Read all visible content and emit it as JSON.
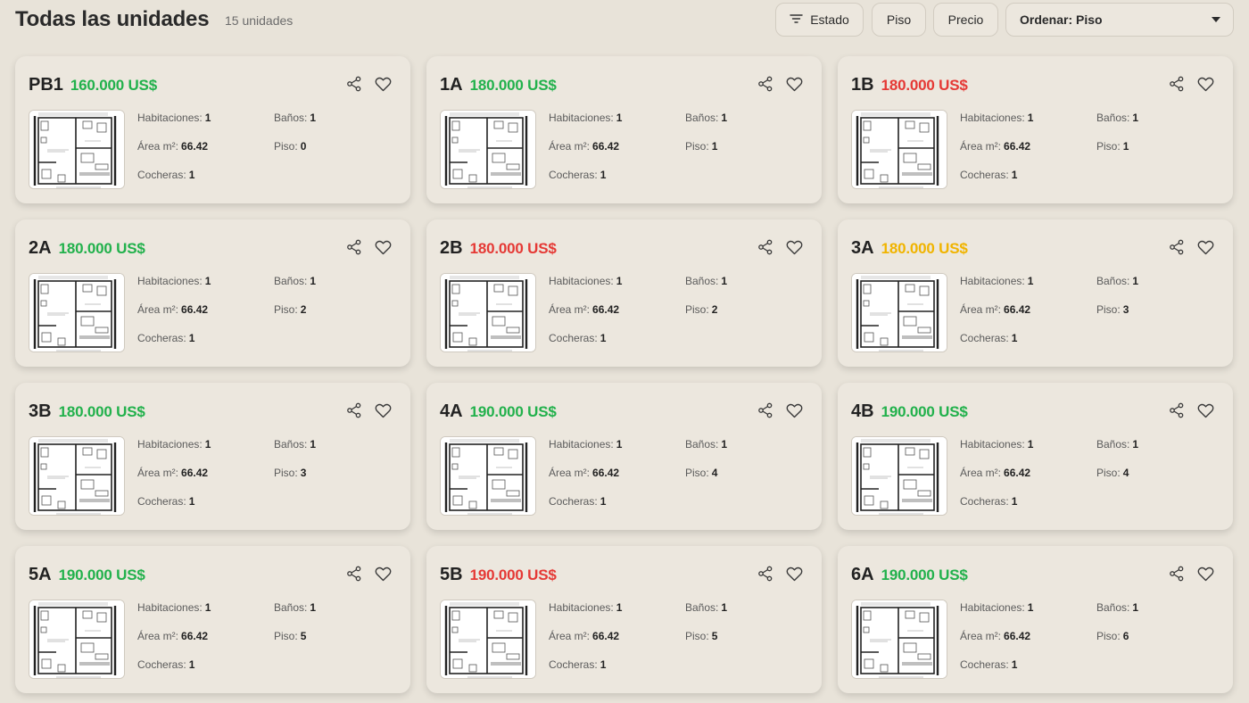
{
  "header": {
    "title": "Todas las unidades",
    "count": "15 unidades",
    "filters": {
      "estado_label": "Estado",
      "piso_label": "Piso",
      "precio_label": "Precio"
    },
    "sort": {
      "label": "Ordenar: Piso"
    }
  },
  "colors": {
    "available": "#22b14c",
    "sold": "#e53935",
    "reserved": "#f0b400"
  },
  "labels": {
    "habitaciones": "Habitaciones:",
    "banos": "Baños:",
    "area": "Área m²:",
    "piso": "Piso:",
    "cocheras": "Cocheras:"
  },
  "units": [
    {
      "name": "PB1",
      "price": "160.000 US$",
      "status": "available",
      "habitaciones": "1",
      "banos": "1",
      "area": "66.42",
      "piso": "0",
      "cocheras": "1"
    },
    {
      "name": "1A",
      "price": "180.000 US$",
      "status": "available",
      "habitaciones": "1",
      "banos": "1",
      "area": "66.42",
      "piso": "1",
      "cocheras": "1"
    },
    {
      "name": "1B",
      "price": "180.000 US$",
      "status": "sold",
      "habitaciones": "1",
      "banos": "1",
      "area": "66.42",
      "piso": "1",
      "cocheras": "1"
    },
    {
      "name": "2A",
      "price": "180.000 US$",
      "status": "available",
      "habitaciones": "1",
      "banos": "1",
      "area": "66.42",
      "piso": "2",
      "cocheras": "1"
    },
    {
      "name": "2B",
      "price": "180.000 US$",
      "status": "sold",
      "habitaciones": "1",
      "banos": "1",
      "area": "66.42",
      "piso": "2",
      "cocheras": "1"
    },
    {
      "name": "3A",
      "price": "180.000 US$",
      "status": "reserved",
      "habitaciones": "1",
      "banos": "1",
      "area": "66.42",
      "piso": "3",
      "cocheras": "1"
    },
    {
      "name": "3B",
      "price": "180.000 US$",
      "status": "available",
      "habitaciones": "1",
      "banos": "1",
      "area": "66.42",
      "piso": "3",
      "cocheras": "1"
    },
    {
      "name": "4A",
      "price": "190.000 US$",
      "status": "available",
      "habitaciones": "1",
      "banos": "1",
      "area": "66.42",
      "piso": "4",
      "cocheras": "1"
    },
    {
      "name": "4B",
      "price": "190.000 US$",
      "status": "available",
      "habitaciones": "1",
      "banos": "1",
      "area": "66.42",
      "piso": "4",
      "cocheras": "1"
    },
    {
      "name": "5A",
      "price": "190.000 US$",
      "status": "available",
      "habitaciones": "1",
      "banos": "1",
      "area": "66.42",
      "piso": "5",
      "cocheras": "1"
    },
    {
      "name": "5B",
      "price": "190.000 US$",
      "status": "sold",
      "habitaciones": "1",
      "banos": "1",
      "area": "66.42",
      "piso": "5",
      "cocheras": "1"
    },
    {
      "name": "6A",
      "price": "190.000 US$",
      "status": "available",
      "habitaciones": "1",
      "banos": "1",
      "area": "66.42",
      "piso": "6",
      "cocheras": "1"
    }
  ]
}
